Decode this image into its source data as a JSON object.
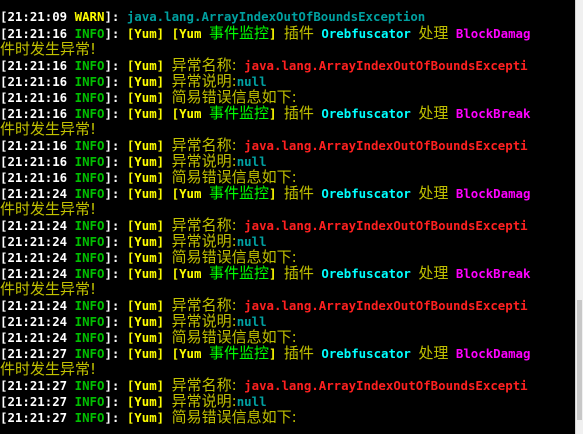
{
  "colors": {
    "background": "#000000",
    "warn": "#ffff00",
    "info": "#00c000",
    "plugin_tag": "#00ff00",
    "exception": "#00a0a0",
    "error_name": "#ff2020",
    "block_event": "#ff00ff",
    "obfuscator": "#00ffff"
  },
  "console": {
    "lines": [
      {
        "time": "[21:21:09 ",
        "level": "WARN",
        "sep": "]: ",
        "text": "java.lang.ArrayIndexOutOfBoundsException"
      },
      {
        "time": "[21:21:16 ",
        "level": "INFO",
        "sep": "]: ",
        "tag": "[Yum]",
        "tag2": "[Yum ",
        "evt": "事件监控",
        "tag2_close": "]",
        "plugin_label": "插件",
        "plugin": "Orebfuscator",
        "handle": "处理",
        "event": "BlockDamag"
      },
      {
        "text": "件时发生异常!"
      },
      {
        "time": "[21:21:16 ",
        "level": "INFO",
        "sep": "]: ",
        "tag": "[Yum]",
        "label": "异常名称:",
        "value": "java.lang.ArrayIndexOutOfBoundsExcepti"
      },
      {
        "time": "[21:21:16 ",
        "level": "INFO",
        "sep": "]: ",
        "tag": "[Yum]",
        "label": "异常说明:",
        "value": "null"
      },
      {
        "time": "[21:21:16 ",
        "level": "INFO",
        "sep": "]: ",
        "tag": "[Yum]",
        "label": "简易错误信息如下:"
      },
      {
        "time": "[21:21:16 ",
        "level": "INFO",
        "sep": "]: ",
        "tag": "[Yum]",
        "tag2": "[Yum ",
        "evt": "事件监控",
        "tag2_close": "]",
        "plugin_label": "插件",
        "plugin": "Orebfuscator",
        "handle": "处理",
        "event": "BlockBreak"
      },
      {
        "text": "件时发生异常!"
      },
      {
        "time": "[21:21:16 ",
        "level": "INFO",
        "sep": "]: ",
        "tag": "[Yum]",
        "label": "异常名称:",
        "value": "java.lang.ArrayIndexOutOfBoundsExcepti"
      },
      {
        "time": "[21:21:16 ",
        "level": "INFO",
        "sep": "]: ",
        "tag": "[Yum]",
        "label": "异常说明:",
        "value": "null"
      },
      {
        "time": "[21:21:16 ",
        "level": "INFO",
        "sep": "]: ",
        "tag": "[Yum]",
        "label": "简易错误信息如下:"
      },
      {
        "time": "[21:21:24 ",
        "level": "INFO",
        "sep": "]: ",
        "tag": "[Yum]",
        "tag2": "[Yum ",
        "evt": "事件监控",
        "tag2_close": "]",
        "plugin_label": "插件",
        "plugin": "Orebfuscator",
        "handle": "处理",
        "event": "BlockDamag"
      },
      {
        "text": "件时发生异常!"
      },
      {
        "time": "[21:21:24 ",
        "level": "INFO",
        "sep": "]: ",
        "tag": "[Yum]",
        "label": "异常名称:",
        "value": "java.lang.ArrayIndexOutOfBoundsExcepti"
      },
      {
        "time": "[21:21:24 ",
        "level": "INFO",
        "sep": "]: ",
        "tag": "[Yum]",
        "label": "异常说明:",
        "value": "null"
      },
      {
        "time": "[21:21:24 ",
        "level": "INFO",
        "sep": "]: ",
        "tag": "[Yum]",
        "label": "简易错误信息如下:"
      },
      {
        "time": "[21:21:24 ",
        "level": "INFO",
        "sep": "]: ",
        "tag": "[Yum]",
        "tag2": "[Yum ",
        "evt": "事件监控",
        "tag2_close": "]",
        "plugin_label": "插件",
        "plugin": "Orebfuscator",
        "handle": "处理",
        "event": "BlockBreak"
      },
      {
        "text": "件时发生异常!"
      },
      {
        "time": "[21:21:24 ",
        "level": "INFO",
        "sep": "]: ",
        "tag": "[Yum]",
        "label": "异常名称:",
        "value": "java.lang.ArrayIndexOutOfBoundsExcepti"
      },
      {
        "time": "[21:21:24 ",
        "level": "INFO",
        "sep": "]: ",
        "tag": "[Yum]",
        "label": "异常说明:",
        "value": "null"
      },
      {
        "time": "[21:21:24 ",
        "level": "INFO",
        "sep": "]: ",
        "tag": "[Yum]",
        "label": "简易错误信息如下:"
      },
      {
        "time": "[21:21:27 ",
        "level": "INFO",
        "sep": "]: ",
        "tag": "[Yum]",
        "tag2": "[Yum ",
        "evt": "事件监控",
        "tag2_close": "]",
        "plugin_label": "插件",
        "plugin": "Orebfuscator",
        "handle": "处理",
        "event": "BlockDamag"
      },
      {
        "text": "件时发生异常!"
      },
      {
        "time": "[21:21:27 ",
        "level": "INFO",
        "sep": "]: ",
        "tag": "[Yum]",
        "label": "异常名称:",
        "value": "java.lang.ArrayIndexOutOfBoundsExcepti"
      },
      {
        "time": "[21:21:27 ",
        "level": "INFO",
        "sep": "]: ",
        "tag": "[Yum]",
        "label": "异常说明:",
        "value": "null"
      },
      {
        "time": "[21:21:27 ",
        "level": "INFO",
        "sep": "]: ",
        "tag": "[Yum]",
        "label": "简易错误信息如下:"
      }
    ]
  }
}
